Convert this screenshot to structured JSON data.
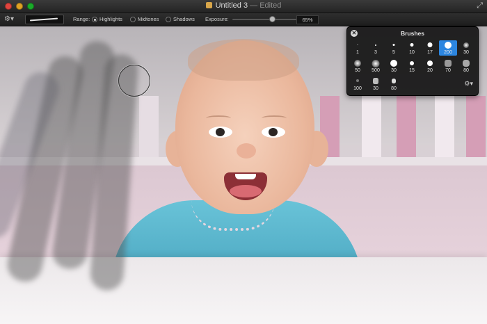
{
  "window": {
    "title": "Untitled 3",
    "status": "— Edited",
    "fullscreen_icon": "fullscreen-arrows-icon"
  },
  "toolbar": {
    "gear_icon": "gear-icon",
    "range_label": "Range:",
    "options": [
      "Highlights",
      "Midtones",
      "Shadows"
    ],
    "selected_option": "Highlights",
    "exposure_label": "Exposure:",
    "exposure_value": "65%",
    "exposure_level": 0.65
  },
  "brushes_panel": {
    "title": "Brushes",
    "close_icon": "close-circle-icon",
    "gear_icon": "gear-icon",
    "selected": "200",
    "sizes": [
      "1",
      "3",
      "5",
      "10",
      "17",
      "200",
      "30",
      "50",
      "500",
      "30",
      "15",
      "20",
      "70",
      "80",
      "100",
      "30",
      "80"
    ]
  }
}
